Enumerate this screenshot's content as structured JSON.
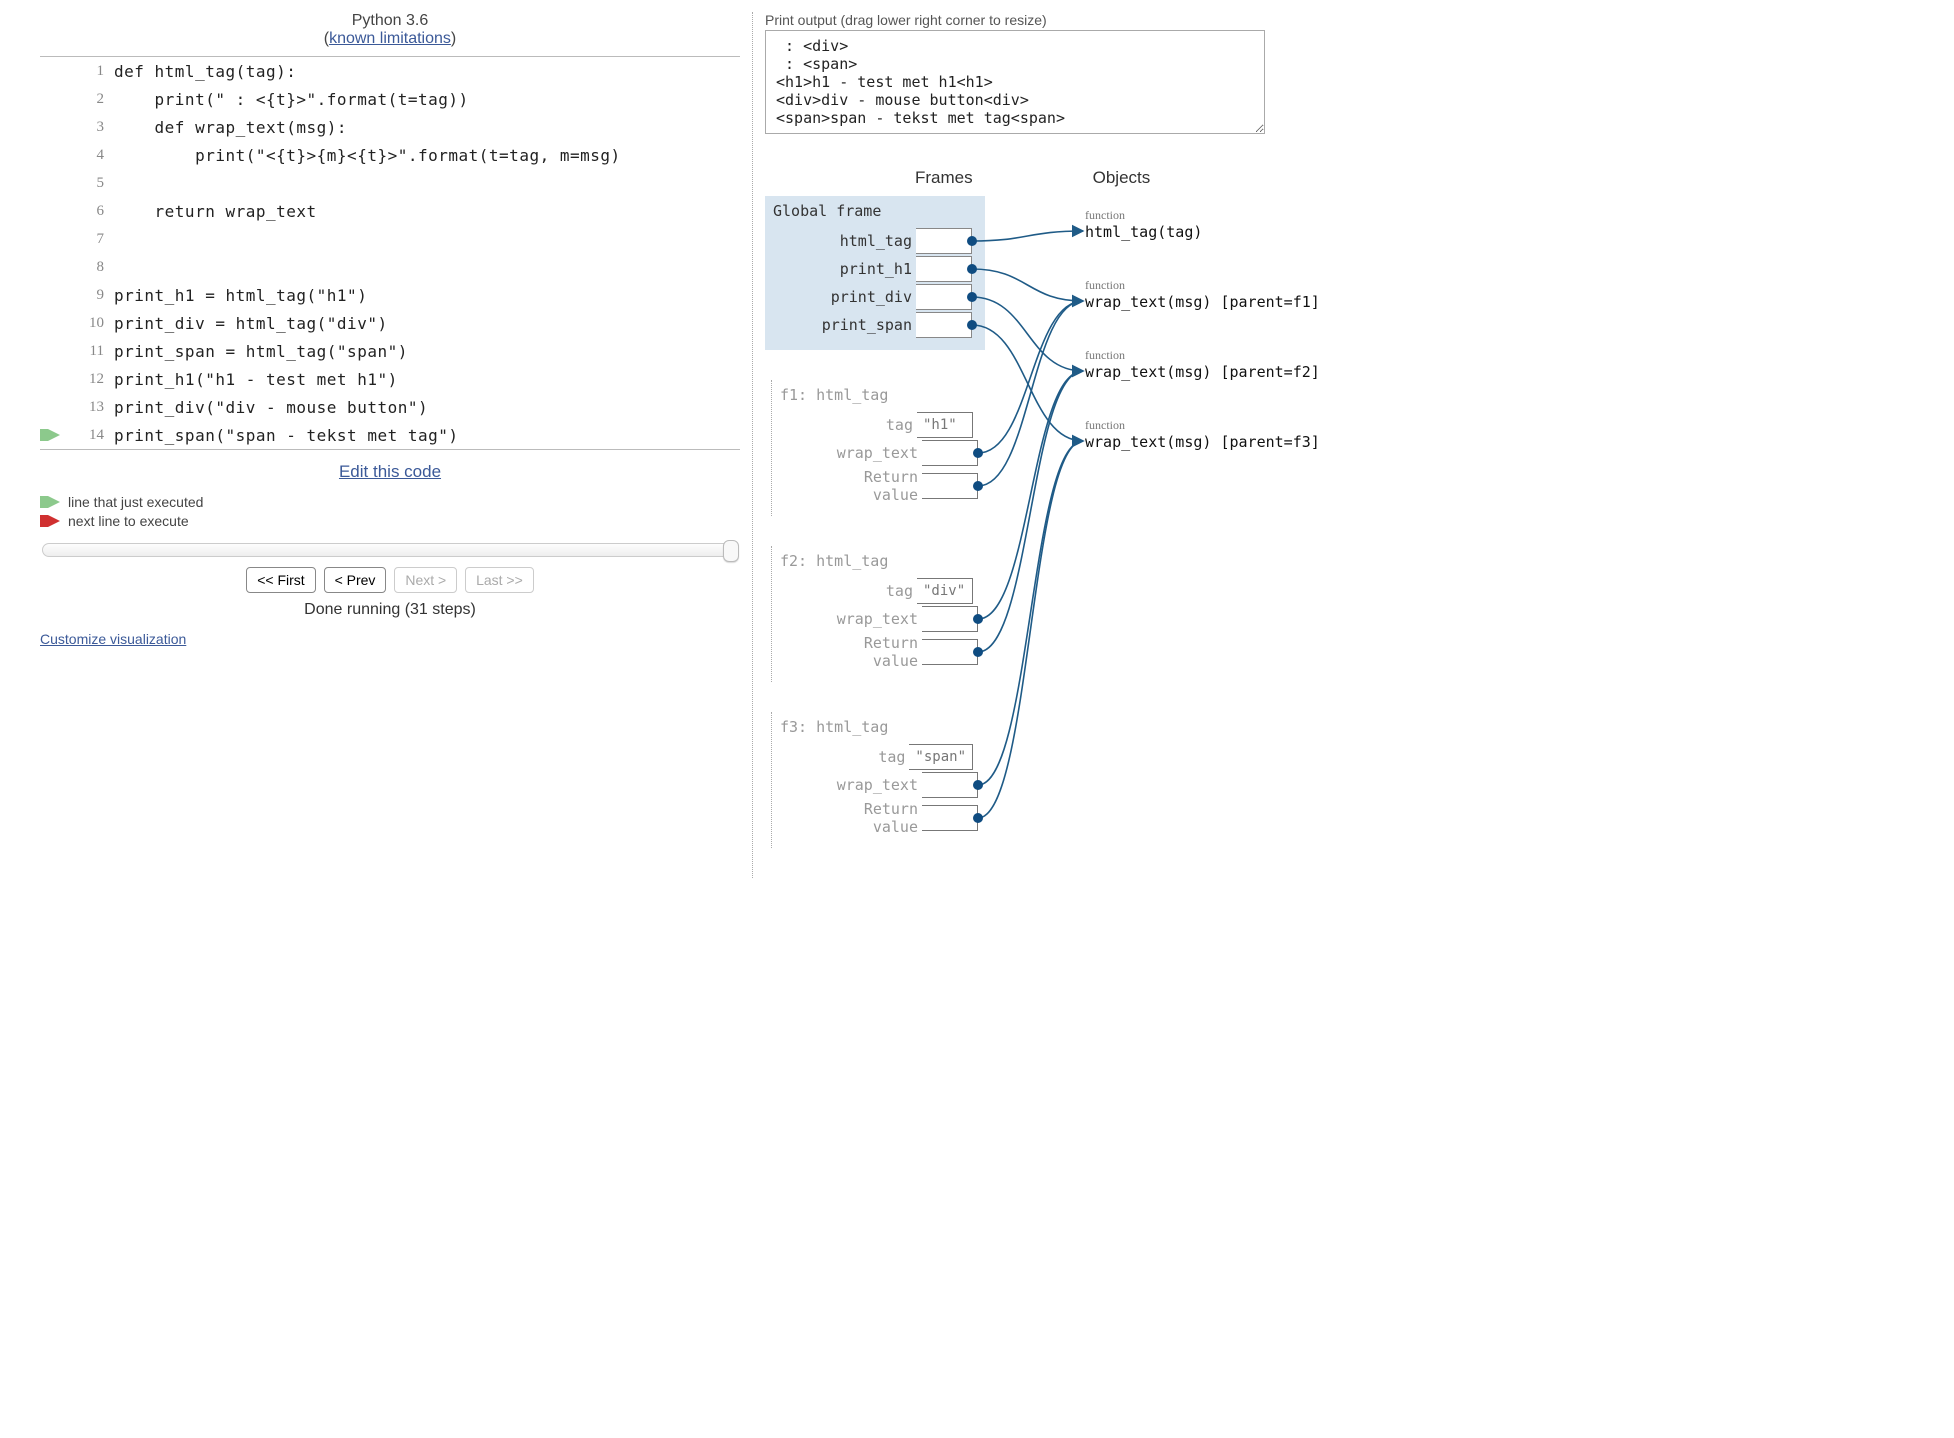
{
  "header": {
    "lang": "Python 3.6",
    "link": "known limitations"
  },
  "code": [
    {
      "n": 1,
      "t": "def html_tag(tag):"
    },
    {
      "n": 2,
      "t": "    print(\" : <{t}>\".format(t=tag))"
    },
    {
      "n": 3,
      "t": "    def wrap_text(msg):"
    },
    {
      "n": 4,
      "t": "        print(\"<{t}>{m}<{t}>\".format(t=tag, m=msg)"
    },
    {
      "n": 5,
      "t": ""
    },
    {
      "n": 6,
      "t": "    return wrap_text"
    },
    {
      "n": 7,
      "t": ""
    },
    {
      "n": 8,
      "t": ""
    },
    {
      "n": 9,
      "t": "print_h1 = html_tag(\"h1\")"
    },
    {
      "n": 10,
      "t": "print_div = html_tag(\"div\")"
    },
    {
      "n": 11,
      "t": "print_span = html_tag(\"span\")"
    },
    {
      "n": 12,
      "t": "print_h1(\"h1 - test met h1\")"
    },
    {
      "n": 13,
      "t": "print_div(\"div - mouse button\")"
    },
    {
      "n": 14,
      "t": "print_span(\"span - tekst met tag\")",
      "arrow": "green"
    }
  ],
  "edit_link": "Edit this code",
  "legend": {
    "prev": "line that just executed",
    "next": "next line to execute"
  },
  "nav": {
    "first": "<< First",
    "prev": "< Prev",
    "next": "Next >",
    "last": "Last >>"
  },
  "status": "Done running (31 steps)",
  "customize": "Customize visualization",
  "output": {
    "label": "Print output (drag lower right corner to resize)",
    "text": " : <div>\n : <span>\n<h1>h1 - test met h1<h1>\n<div>div - mouse button<div>\n<span>span - tekst met tag<span>"
  },
  "fo_head": {
    "frames": "Frames",
    "objects": "Objects"
  },
  "frames": {
    "global": {
      "title": "Global frame",
      "vars": [
        "html_tag",
        "print_h1",
        "print_div",
        "print_span"
      ]
    },
    "f1": {
      "title": "f1: html_tag",
      "tag": "\"h1\"",
      "vars": [
        "tag",
        "wrap_text",
        "Return\nvalue"
      ]
    },
    "f2": {
      "title": "f2: html_tag",
      "tag": "\"div\"",
      "vars": [
        "tag",
        "wrap_text",
        "Return\nvalue"
      ]
    },
    "f3": {
      "title": "f3: html_tag",
      "tag": "\"span\"",
      "vars": [
        "tag",
        "wrap_text",
        "Return\nvalue"
      ]
    }
  },
  "objects": [
    {
      "type": "function",
      "sig": "html_tag(tag)"
    },
    {
      "type": "function",
      "sig": "wrap_text(msg) [parent=f1]"
    },
    {
      "type": "function",
      "sig": "wrap_text(msg) [parent=f2]"
    },
    {
      "type": "function",
      "sig": "wrap_text(msg) [parent=f3]"
    }
  ],
  "colors": {
    "arrow": "#1f5b87",
    "green": "#8cc98c",
    "red": "#d03030"
  }
}
